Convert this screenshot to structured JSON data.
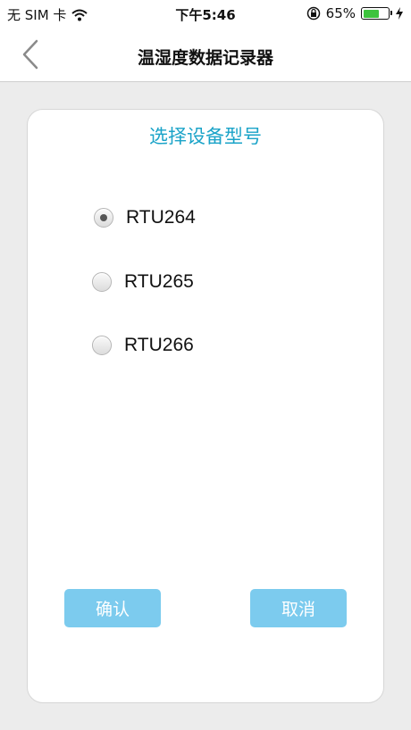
{
  "status_bar": {
    "carrier": "无 SIM 卡",
    "time": "下午5:46",
    "battery_percent": "65%",
    "battery_level": 0.65
  },
  "nav": {
    "title": "温湿度数据记录器"
  },
  "dialog": {
    "title": "选择设备型号",
    "options": [
      {
        "label": "RTU264",
        "selected": true
      },
      {
        "label": "RTU265",
        "selected": false
      },
      {
        "label": "RTU266",
        "selected": false
      }
    ],
    "confirm_label": "确认",
    "cancel_label": "取消"
  },
  "colors": {
    "accent_title": "#1aa3c8",
    "button_bg": "#7ccbee",
    "page_bg": "#ececec"
  }
}
